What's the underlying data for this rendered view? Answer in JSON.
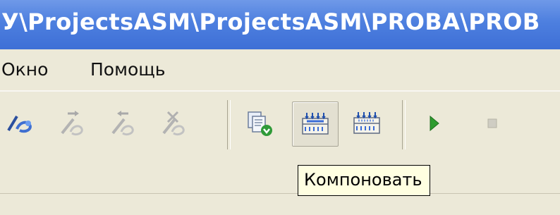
{
  "window": {
    "title": "У\\ProjectsASM\\ProjectsASM\\PROBA\\PROB"
  },
  "menu": {
    "items": [
      {
        "label": "Окно"
      },
      {
        "label": "Помощь"
      }
    ]
  },
  "toolbar": {
    "buttons": [
      {
        "icon": "breakpoint-icon",
        "enabled": true
      },
      {
        "icon": "step-into-icon",
        "enabled": false
      },
      {
        "icon": "step-out-icon",
        "enabled": false
      },
      {
        "icon": "step-over-icon",
        "enabled": false
      },
      {
        "icon": "download-icon",
        "enabled": true
      },
      {
        "icon": "build-icon",
        "enabled": true,
        "pressed": true
      },
      {
        "icon": "rebuild-icon",
        "enabled": true
      },
      {
        "icon": "run-icon",
        "enabled": true
      },
      {
        "icon": "stop-icon",
        "enabled": false
      }
    ]
  },
  "tooltip": {
    "text": "Компоновать"
  },
  "colors": {
    "titlebar": "#4d7fdf",
    "face": "#ece9d8",
    "tooltip_bg": "#ffffe1",
    "run_green": "#2e9b2e"
  }
}
